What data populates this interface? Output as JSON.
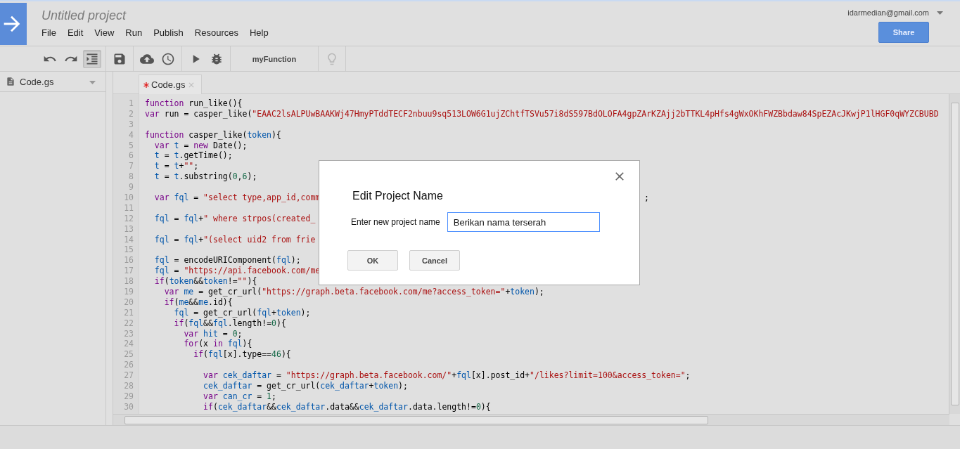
{
  "app": {
    "project_title": "Untitled project",
    "menu": [
      "File",
      "Edit",
      "View",
      "Run",
      "Publish",
      "Resources",
      "Help"
    ],
    "account": "idarmedian@gmail.com",
    "share_button": "Share"
  },
  "toolbar": [
    {
      "kind": "undo"
    },
    {
      "kind": "redo"
    },
    {
      "kind": "indent",
      "selected": true
    },
    {
      "kind": "save"
    },
    {
      "kind": "cloud"
    },
    {
      "kind": "clock"
    },
    {
      "kind": "run"
    },
    {
      "kind": "debug"
    },
    {
      "kind": "function",
      "label": "myFunction"
    },
    {
      "kind": "bulb",
      "disabled": true
    }
  ],
  "sidebar": {
    "files": [
      {
        "name": "Code.gs"
      }
    ]
  },
  "tabs": [
    {
      "label": "Code.gs",
      "modified": true,
      "selected": true
    }
  ],
  "code": {
    "lines": [
      {
        "number": "1",
        "segments": [
          {
            "kind": "keyword",
            "text": "function"
          },
          {
            "kind": "plain",
            "text": " run_like(){"
          }
        ]
      },
      {
        "number": "2",
        "segments": [
          {
            "kind": "keyword",
            "text": "var"
          },
          {
            "kind": "plain",
            "text": " run = casper_like("
          },
          {
            "kind": "string",
            "text": "\"EAAC2lsALPUwBAAKWj47HmyPTddTECF2nbuu9sq513LOW6G1ujZChtfTSVu57i8dS597BdOLOFA4gpZArKZAjj2bTTKL4pHfs4gWxOKhFWZBbdaw84SpEZAcJKwjP1lHGF0qWYZCBUBD"
          }
        ]
      },
      {
        "number": "3"
      },
      {
        "number": "4",
        "segments": [
          {
            "kind": "keyword",
            "text": "function"
          },
          {
            "kind": "plain",
            "text": " casper_like("
          },
          {
            "kind": "variable",
            "text": "token"
          },
          {
            "kind": "plain",
            "text": "){"
          }
        ]
      },
      {
        "number": "5",
        "segments": [
          {
            "kind": "keyword",
            "text": "  var "
          },
          {
            "kind": "variable",
            "text": "t"
          },
          {
            "kind": "plain",
            "text": " = "
          },
          {
            "kind": "keyword",
            "text": "new"
          },
          {
            "kind": "plain",
            "text": " Date();"
          }
        ]
      },
      {
        "number": "6",
        "segments": [
          {
            "kind": "variable",
            "text": "  t"
          },
          {
            "kind": "plain",
            "text": " = "
          },
          {
            "kind": "variable",
            "text": "t"
          },
          {
            "kind": "plain",
            "text": ".getTime();"
          }
        ]
      },
      {
        "number": "7",
        "segments": [
          {
            "kind": "variable",
            "text": "  t"
          },
          {
            "kind": "plain",
            "text": " = "
          },
          {
            "kind": "variable",
            "text": "t"
          },
          {
            "kind": "plain",
            "text": "+"
          },
          {
            "kind": "string",
            "text": "\"\""
          },
          {
            "kind": "plain",
            "text": ";"
          }
        ]
      },
      {
        "number": "8",
        "segments": [
          {
            "kind": "variable",
            "text": "  t"
          },
          {
            "kind": "plain",
            "text": " = "
          },
          {
            "kind": "variable",
            "text": "t"
          },
          {
            "kind": "plain",
            "text": ".substring("
          },
          {
            "kind": "number",
            "text": "0"
          },
          {
            "kind": "plain",
            "text": ","
          },
          {
            "kind": "number",
            "text": "6"
          },
          {
            "kind": "plain",
            "text": ");"
          }
        ]
      },
      {
        "number": "9"
      },
      {
        "number": "10",
        "segments": [
          {
            "kind": "keyword",
            "text": "  var "
          },
          {
            "kind": "variable",
            "text": "fql"
          },
          {
            "kind": "plain",
            "text": " = "
          },
          {
            "kind": "string",
            "text": "\"select type,app_id,comm"
          }
        ],
        "tail": ";"
      },
      {
        "number": "11"
      },
      {
        "number": "12",
        "segments": [
          {
            "kind": "variable",
            "text": "  fql"
          },
          {
            "kind": "plain",
            "text": " = "
          },
          {
            "kind": "variable",
            "text": "fql"
          },
          {
            "kind": "plain",
            "text": "+"
          },
          {
            "kind": "string",
            "text": "\" where strpos(created_"
          }
        ]
      },
      {
        "number": "13"
      },
      {
        "number": "14",
        "segments": [
          {
            "kind": "variable",
            "text": "  fql"
          },
          {
            "kind": "plain",
            "text": " = "
          },
          {
            "kind": "variable",
            "text": "fql"
          },
          {
            "kind": "plain",
            "text": "+"
          },
          {
            "kind": "string",
            "text": "\"(select uid2 from frie"
          }
        ]
      },
      {
        "number": "15"
      },
      {
        "number": "16",
        "segments": [
          {
            "kind": "variable",
            "text": "  fql"
          },
          {
            "kind": "plain",
            "text": " = encodeURIComponent("
          },
          {
            "kind": "variable",
            "text": "fql"
          },
          {
            "kind": "plain",
            "text": ");"
          }
        ]
      },
      {
        "number": "17",
        "segments": [
          {
            "kind": "variable",
            "text": "  fql"
          },
          {
            "kind": "plain",
            "text": " = "
          },
          {
            "kind": "string",
            "text": "\"https://api.facebook.com/me"
          }
        ]
      },
      {
        "number": "18",
        "segments": [
          {
            "kind": "keyword",
            "text": "  if"
          },
          {
            "kind": "plain",
            "text": "("
          },
          {
            "kind": "variable",
            "text": "token"
          },
          {
            "kind": "plain",
            "text": "&&"
          },
          {
            "kind": "variable",
            "text": "token"
          },
          {
            "kind": "plain",
            "text": "!="
          },
          {
            "kind": "string",
            "text": "\"\""
          },
          {
            "kind": "plain",
            "text": "){"
          }
        ]
      },
      {
        "number": "19",
        "segments": [
          {
            "kind": "keyword",
            "text": "    var "
          },
          {
            "kind": "variable",
            "text": "me"
          },
          {
            "kind": "plain",
            "text": " = get_cr_url("
          },
          {
            "kind": "string",
            "text": "\"https://graph.beta.facebook.com/me?access_token=\""
          },
          {
            "kind": "plain",
            "text": "+"
          },
          {
            "kind": "variable",
            "text": "token"
          },
          {
            "kind": "plain",
            "text": ");"
          }
        ]
      },
      {
        "number": "20",
        "segments": [
          {
            "kind": "keyword",
            "text": "    if"
          },
          {
            "kind": "plain",
            "text": "("
          },
          {
            "kind": "variable",
            "text": "me"
          },
          {
            "kind": "plain",
            "text": "&&"
          },
          {
            "kind": "variable",
            "text": "me"
          },
          {
            "kind": "plain",
            "text": ".id){"
          }
        ]
      },
      {
        "number": "21",
        "segments": [
          {
            "kind": "variable",
            "text": "      fql"
          },
          {
            "kind": "plain",
            "text": " = get_cr_url("
          },
          {
            "kind": "variable",
            "text": "fql"
          },
          {
            "kind": "plain",
            "text": "+"
          },
          {
            "kind": "variable",
            "text": "token"
          },
          {
            "kind": "plain",
            "text": ");"
          }
        ]
      },
      {
        "number": "22",
        "segments": [
          {
            "kind": "keyword",
            "text": "      if"
          },
          {
            "kind": "plain",
            "text": "("
          },
          {
            "kind": "variable",
            "text": "fql"
          },
          {
            "kind": "plain",
            "text": "&&"
          },
          {
            "kind": "variable",
            "text": "fql"
          },
          {
            "kind": "plain",
            "text": ".length!="
          },
          {
            "kind": "number",
            "text": "0"
          },
          {
            "kind": "plain",
            "text": "){"
          }
        ]
      },
      {
        "number": "23",
        "segments": [
          {
            "kind": "keyword",
            "text": "        var "
          },
          {
            "kind": "variable",
            "text": "hit"
          },
          {
            "kind": "plain",
            "text": " = "
          },
          {
            "kind": "number",
            "text": "0"
          },
          {
            "kind": "plain",
            "text": ";"
          }
        ]
      },
      {
        "number": "24",
        "segments": [
          {
            "kind": "keyword",
            "text": "        for"
          },
          {
            "kind": "plain",
            "text": "(x "
          },
          {
            "kind": "keyword",
            "text": "in "
          },
          {
            "kind": "variable",
            "text": "fql"
          },
          {
            "kind": "plain",
            "text": "){"
          }
        ]
      },
      {
        "number": "25",
        "segments": [
          {
            "kind": "keyword",
            "text": "          if"
          },
          {
            "kind": "plain",
            "text": "("
          },
          {
            "kind": "variable",
            "text": "fql"
          },
          {
            "kind": "plain",
            "text": "[x].type=="
          },
          {
            "kind": "number",
            "text": "46"
          },
          {
            "kind": "plain",
            "text": "){"
          }
        ]
      },
      {
        "number": "26"
      },
      {
        "number": "27",
        "segments": [
          {
            "kind": "keyword",
            "text": "            var "
          },
          {
            "kind": "variable",
            "text": "cek_daftar"
          },
          {
            "kind": "plain",
            "text": " = "
          },
          {
            "kind": "string",
            "text": "\"https://graph.beta.facebook.com/\""
          },
          {
            "kind": "plain",
            "text": "+"
          },
          {
            "kind": "variable",
            "text": "fql"
          },
          {
            "kind": "plain",
            "text": "[x].post_id+"
          },
          {
            "kind": "string",
            "text": "\"/likes?limit=100&access_token=\""
          },
          {
            "kind": "plain",
            "text": ";"
          }
        ]
      },
      {
        "number": "28",
        "segments": [
          {
            "kind": "variable",
            "text": "            cek_daftar"
          },
          {
            "kind": "plain",
            "text": " = get_cr_url("
          },
          {
            "kind": "variable",
            "text": "cek_daftar"
          },
          {
            "kind": "plain",
            "text": "+"
          },
          {
            "kind": "variable",
            "text": "token"
          },
          {
            "kind": "plain",
            "text": ");"
          }
        ]
      },
      {
        "number": "29",
        "segments": [
          {
            "kind": "keyword",
            "text": "            var "
          },
          {
            "kind": "variable",
            "text": "can_cr"
          },
          {
            "kind": "plain",
            "text": " = "
          },
          {
            "kind": "number",
            "text": "1"
          },
          {
            "kind": "plain",
            "text": ";"
          }
        ]
      },
      {
        "number": "30",
        "segments": [
          {
            "kind": "keyword",
            "text": "            if"
          },
          {
            "kind": "plain",
            "text": "("
          },
          {
            "kind": "variable",
            "text": "cek_daftar"
          },
          {
            "kind": "plain",
            "text": "&&"
          },
          {
            "kind": "variable",
            "text": "cek_daftar"
          },
          {
            "kind": "plain",
            "text": ".data&&"
          },
          {
            "kind": "variable",
            "text": "cek_daftar"
          },
          {
            "kind": "plain",
            "text": ".data.length!="
          },
          {
            "kind": "number",
            "text": "0"
          },
          {
            "kind": "plain",
            "text": "){"
          }
        ]
      }
    ]
  },
  "dialog": {
    "title": "Edit Project Name",
    "field_label": "Enter new project name",
    "value": "Berikan nama terserah",
    "buttons": [
      "OK",
      "Cancel"
    ]
  }
}
